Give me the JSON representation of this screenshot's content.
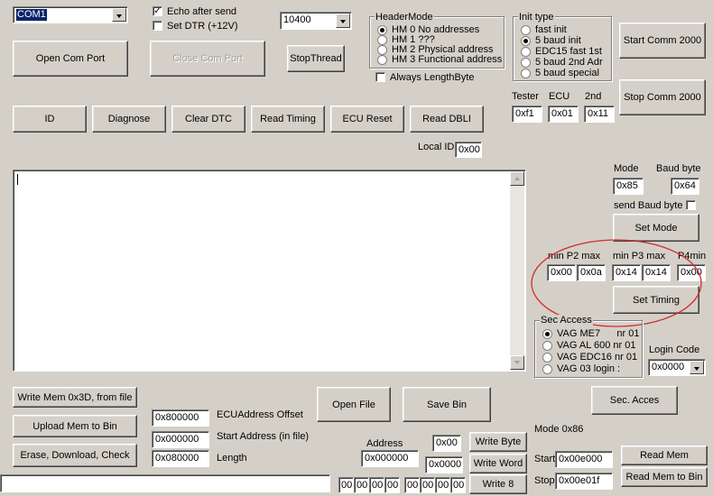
{
  "com_port": {
    "value": "COM1"
  },
  "echo_after_send": {
    "label": "Echo after send",
    "checked": true
  },
  "set_dtr": {
    "label": "Set DTR (+12V)",
    "checked": false
  },
  "baud_rate": {
    "value": "10400"
  },
  "buttons": {
    "open_com_port": "Open Com Port",
    "close_com_port": "Close Com Port",
    "stop_thread": "StopThread",
    "start_comm": "Start Comm 2000",
    "stop_comm": "Stop  Comm 2000",
    "id": "ID",
    "diagnose": "Diagnose",
    "clear_dtc": "Clear DTC",
    "read_timing": "Read Timing",
    "ecu_reset": "ECU Reset",
    "read_dbli": "Read DBLI",
    "set_mode": "Set Mode",
    "set_timing": "Set Timing",
    "write_mem": "Write Mem 0x3D, from file",
    "upload_mem": "Upload Mem to Bin",
    "erase_download": "Erase, Download, Check",
    "open_file": "Open File",
    "save_bin": "Save Bin",
    "sec_acces": "Sec. Acces",
    "write_byte": "Write Byte",
    "write_word": "Write Word",
    "write_8": "Write 8",
    "read_mem": "Read Mem",
    "read_mem_to_bin": "Read Mem to Bin"
  },
  "header_mode": {
    "title": "HeaderMode",
    "options": [
      "HM 0 No addresses",
      "HM 1 ???",
      "HM 2 Physical address",
      "HM 3 Functional address"
    ],
    "selected": 0,
    "always_length_byte": "Always LengthByte"
  },
  "init_type": {
    "title": "Init type",
    "options": [
      "fast init",
      "5 baud init",
      "EDC15 fast 1st",
      "5 baud 2nd Adr",
      "5 baud special"
    ],
    "selected": 1
  },
  "addresses": {
    "tester_label": "Tester",
    "tester_value": "0xf1",
    "ecu_label": "ECU",
    "ecu_value": "0x01",
    "second_label": "2nd",
    "second_value": "0x11",
    "local_id_label": "Local ID",
    "local_id_value": "0x00"
  },
  "mode": {
    "label": "Mode",
    "value": "0x85",
    "baud_byte_label": "Baud byte",
    "baud_byte_value": "0x64",
    "send_baud_byte": "send Baud byte"
  },
  "timing": {
    "p2_label": "min P2 max",
    "p2_min": "0x00",
    "p2_max": "0x0a",
    "p3_label": "min P3 max",
    "p3_min": "0x14",
    "p3_max": "0x14",
    "p4_label": "P4min",
    "p4_value": "0x00"
  },
  "sec_access": {
    "title": "Sec Access",
    "options": [
      "VAG ME7      nr 01",
      "VAG AL 600 nr 01",
      "VAG EDC16 nr 01",
      "VAG 03 login :"
    ],
    "selected": 0,
    "login_code_label": "Login Code",
    "login_code_value": "0x0000"
  },
  "memory": {
    "ecu_offset_value": "0x800000",
    "ecu_offset_label": "ECUAddress Offset",
    "start_address_value": "0x000000",
    "start_address_label": "Start Address (in file)",
    "length_value": "0x080000",
    "length_label": "Length",
    "address_label": "Address",
    "address_value": "0x000000",
    "byte_value": "0x00",
    "word_value": "0x0000",
    "bytes8": [
      "00",
      "00",
      "00",
      "00",
      "00",
      "00",
      "00",
      "00"
    ],
    "mode_label": "Mode 0x86",
    "start_label": "Start",
    "start_value": "0x00e000",
    "stop_label": "Stop",
    "stop_value": "0x00e01f"
  },
  "output": {
    "text": ""
  },
  "status_field": {
    "value": ""
  },
  "colors": {
    "window_bg": "#d4d0c8",
    "annotation_ellipse": "#d42a2a"
  }
}
